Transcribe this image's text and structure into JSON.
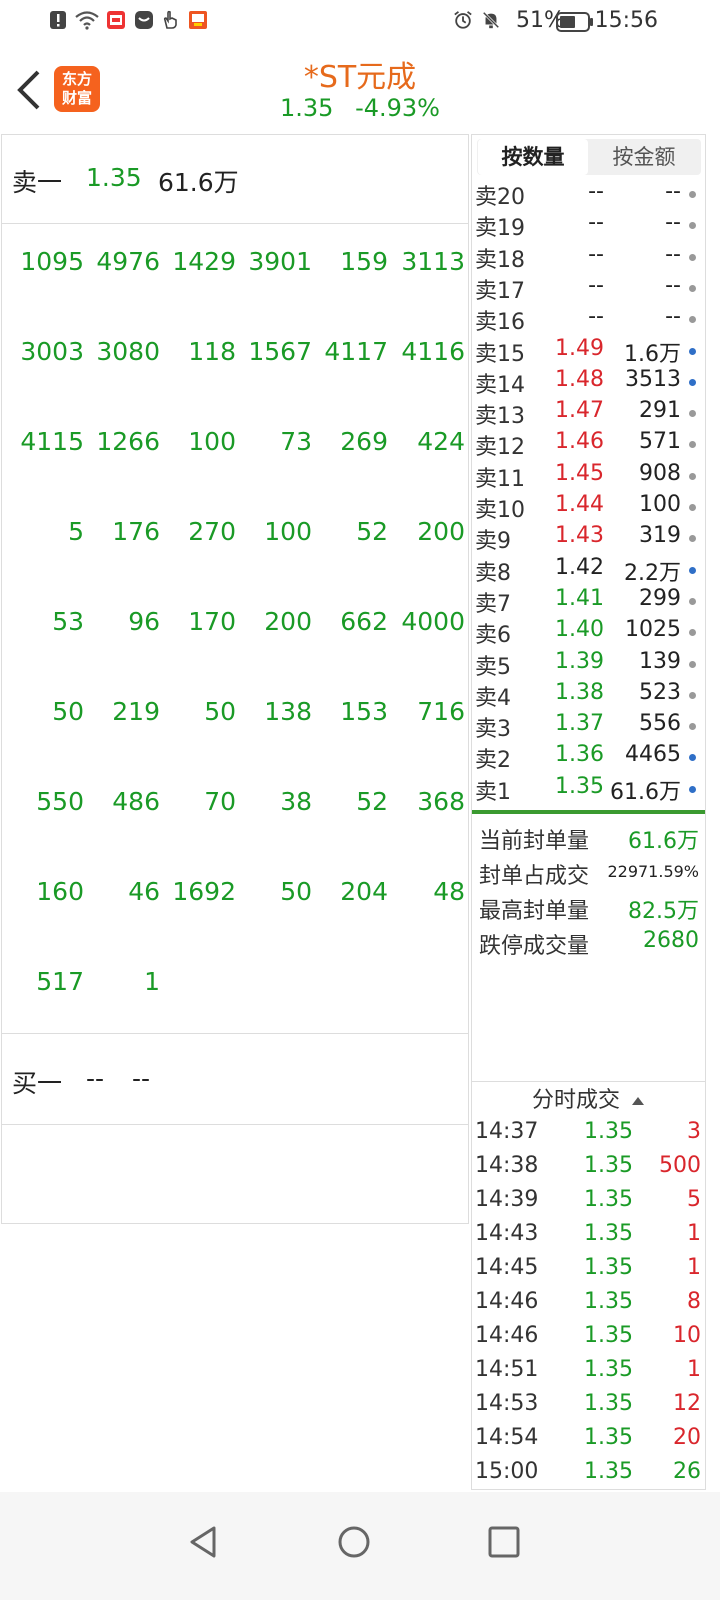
{
  "status_bar": {
    "icons": [
      "alert-icon",
      "wifi-icon",
      "app-badge-icon",
      "message-icon",
      "hand-icon",
      "taobao-icon",
      "alarm-icon",
      "mute-icon",
      "battery-icon"
    ],
    "battery": "51%",
    "time": "15:56"
  },
  "header": {
    "stock_name": "*ST元成",
    "price": "1.35",
    "change": "-4.93%",
    "logo_line1": "东方",
    "logo_line2": "财富"
  },
  "left_panel": {
    "sell1": {
      "label": "卖一",
      "price": "1.35",
      "volume": "61.6万"
    },
    "orders": [
      [
        "1095",
        "4976",
        "1429",
        "3901",
        "159",
        "3113"
      ],
      [
        "3003",
        "3080",
        "118",
        "1567",
        "4117",
        "4116"
      ],
      [
        "4115",
        "1266",
        "100",
        "73",
        "269",
        "424"
      ],
      [
        "5",
        "176",
        "270",
        "100",
        "52",
        "200"
      ],
      [
        "53",
        "96",
        "170",
        "200",
        "662",
        "4000"
      ],
      [
        "50",
        "219",
        "50",
        "138",
        "153",
        "716"
      ],
      [
        "550",
        "486",
        "70",
        "38",
        "52",
        "368"
      ],
      [
        "160",
        "46",
        "1692",
        "50",
        "204",
        "48"
      ],
      [
        "517",
        "1"
      ]
    ],
    "buy1": {
      "label": "买一",
      "price": "--",
      "volume": "--"
    }
  },
  "right_panel": {
    "tabs": {
      "by_count": "按数量",
      "by_amount": "按金额"
    },
    "levels": [
      {
        "label": "卖20",
        "price": "--",
        "volume": "--",
        "color": "dark",
        "dot": "grey"
      },
      {
        "label": "卖19",
        "price": "--",
        "volume": "--",
        "color": "dark",
        "dot": "grey"
      },
      {
        "label": "卖18",
        "price": "--",
        "volume": "--",
        "color": "dark",
        "dot": "grey"
      },
      {
        "label": "卖17",
        "price": "--",
        "volume": "--",
        "color": "dark",
        "dot": "grey"
      },
      {
        "label": "卖16",
        "price": "--",
        "volume": "--",
        "color": "dark",
        "dot": "grey"
      },
      {
        "label": "卖15",
        "price": "1.49",
        "volume": "1.6万",
        "color": "red",
        "dot": "blue"
      },
      {
        "label": "卖14",
        "price": "1.48",
        "volume": "3513",
        "color": "red",
        "dot": "blue"
      },
      {
        "label": "卖13",
        "price": "1.47",
        "volume": "291",
        "color": "red",
        "dot": "grey"
      },
      {
        "label": "卖12",
        "price": "1.46",
        "volume": "571",
        "color": "red",
        "dot": "grey"
      },
      {
        "label": "卖11",
        "price": "1.45",
        "volume": "908",
        "color": "red",
        "dot": "grey"
      },
      {
        "label": "卖10",
        "price": "1.44",
        "volume": "100",
        "color": "red",
        "dot": "grey"
      },
      {
        "label": "卖9",
        "price": "1.43",
        "volume": "319",
        "color": "red",
        "dot": "grey"
      },
      {
        "label": "卖8",
        "price": "1.42",
        "volume": "2.2万",
        "color": "dark",
        "dot": "blue"
      },
      {
        "label": "卖7",
        "price": "1.41",
        "volume": "299",
        "color": "green",
        "dot": "grey"
      },
      {
        "label": "卖6",
        "price": "1.40",
        "volume": "1025",
        "color": "green",
        "dot": "grey"
      },
      {
        "label": "卖5",
        "price": "1.39",
        "volume": "139",
        "color": "green",
        "dot": "grey"
      },
      {
        "label": "卖4",
        "price": "1.38",
        "volume": "523",
        "color": "green",
        "dot": "grey"
      },
      {
        "label": "卖3",
        "price": "1.37",
        "volume": "556",
        "color": "green",
        "dot": "grey"
      },
      {
        "label": "卖2",
        "price": "1.36",
        "volume": "4465",
        "color": "green",
        "dot": "blue"
      },
      {
        "label": "卖1",
        "price": "1.35",
        "volume": "61.6万",
        "color": "green",
        "dot": "blue"
      }
    ],
    "stats": [
      {
        "label": "当前封单量",
        "value": "61.6万",
        "color": "green",
        "small": false
      },
      {
        "label": "封单占成交",
        "value": "22971.59%",
        "color": "dark",
        "small": true
      },
      {
        "label": "最高封单量",
        "value": "82.5万",
        "color": "green",
        "small": false
      },
      {
        "label": "跌停成交量",
        "value": "2680",
        "color": "green",
        "small": false
      }
    ],
    "ticks_title": "分时成交",
    "ticks": [
      {
        "time": "14:37",
        "price": "1.35",
        "vol": "3",
        "color": "red"
      },
      {
        "time": "14:38",
        "price": "1.35",
        "vol": "500",
        "color": "red"
      },
      {
        "time": "14:39",
        "price": "1.35",
        "vol": "5",
        "color": "red"
      },
      {
        "time": "14:43",
        "price": "1.35",
        "vol": "1",
        "color": "red"
      },
      {
        "time": "14:45",
        "price": "1.35",
        "vol": "1",
        "color": "red"
      },
      {
        "time": "14:46",
        "price": "1.35",
        "vol": "8",
        "color": "red"
      },
      {
        "time": "14:46",
        "price": "1.35",
        "vol": "10",
        "color": "red"
      },
      {
        "time": "14:51",
        "price": "1.35",
        "vol": "1",
        "color": "red"
      },
      {
        "time": "14:53",
        "price": "1.35",
        "vol": "12",
        "color": "red"
      },
      {
        "time": "14:54",
        "price": "1.35",
        "vol": "20",
        "color": "red"
      },
      {
        "time": "15:00",
        "price": "1.35",
        "vol": "26",
        "color": "green"
      }
    ]
  },
  "nav_bar": {
    "buttons": [
      "back-nav-icon",
      "home-nav-icon",
      "recents-nav-icon"
    ]
  }
}
